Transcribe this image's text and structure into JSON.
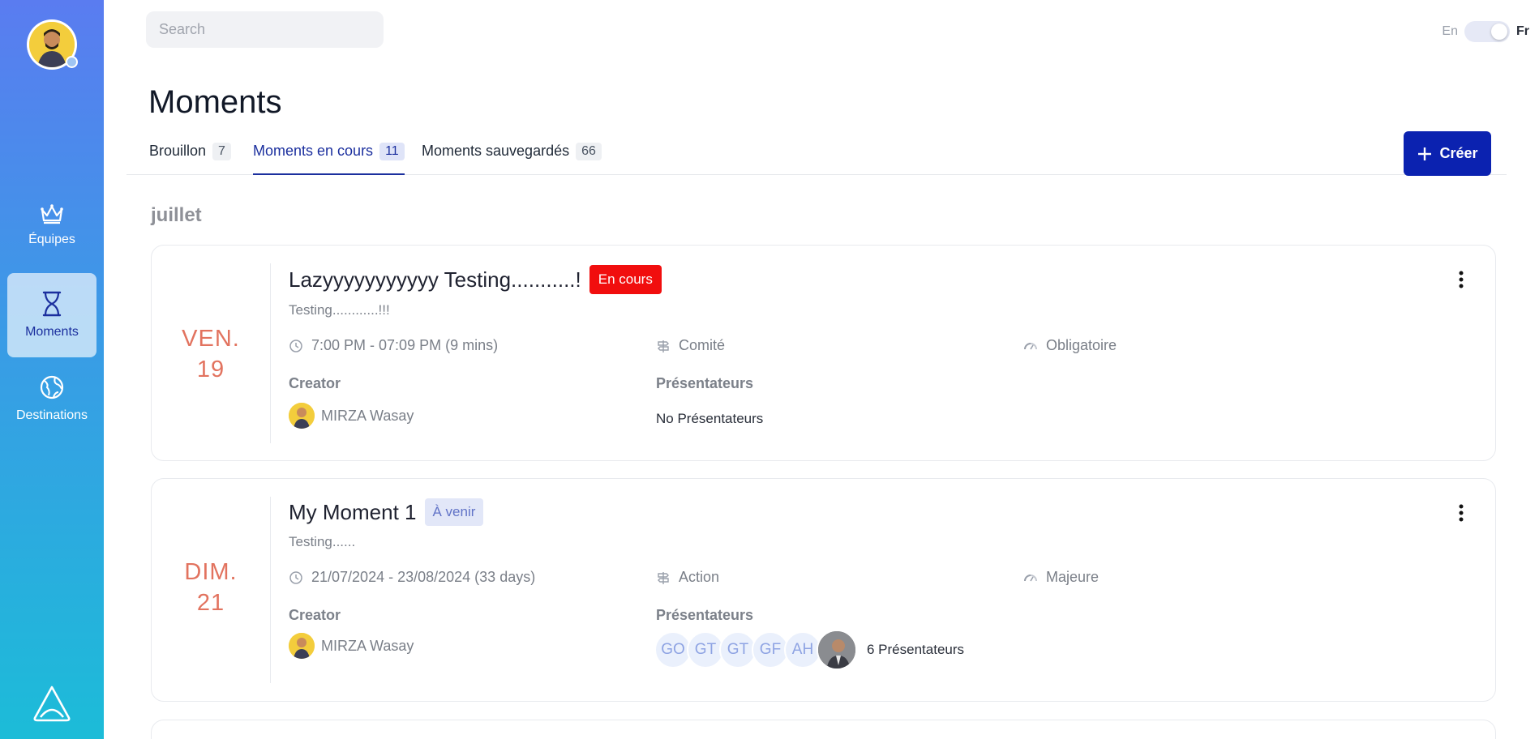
{
  "sidebar": {
    "items": [
      {
        "label": "Équipes",
        "icon": "crown-icon",
        "active": false
      },
      {
        "label": "Moments",
        "icon": "hourglass-icon",
        "active": true
      },
      {
        "label": "Destinations",
        "icon": "globe-icon",
        "active": false
      }
    ]
  },
  "search": {
    "placeholder": "Search"
  },
  "language": {
    "en": "En",
    "fr": "Fr",
    "selected": "Fr"
  },
  "page": {
    "title": "Moments"
  },
  "tabs": [
    {
      "label": "Brouillon",
      "count": "7"
    },
    {
      "label": "Moments en cours",
      "count": "11",
      "active": true
    },
    {
      "label": "Moments sauvegardés",
      "count": "66"
    }
  ],
  "create_button": {
    "label": "Créer"
  },
  "month": "juillet",
  "moments": [
    {
      "day": "VEN.",
      "date": "19",
      "title": "Lazyyyyyyyyyyy Testing...........!",
      "status": "En cours",
      "description": "Testing............!!!",
      "time": "7:00 PM - 07:09 PM (9 mins)",
      "category": "Comité",
      "importance": "Obligatoire",
      "creator_label": "Creator",
      "creator_name": "MIRZA Wasay",
      "presenters_label": "Présentateurs",
      "presenters_text": "No Présentateurs"
    },
    {
      "day": "DIM.",
      "date": "21",
      "title": "My Moment 1",
      "status": "À venir",
      "description": "Testing......",
      "time": "21/07/2024 - 23/08/2024 (33 days)",
      "category": "Action",
      "importance": "Majeure",
      "creator_label": "Creator",
      "creator_name": "MIRZA Wasay",
      "presenters_label": "Présentateurs",
      "presenter_initials": [
        "GO",
        "GT",
        "GT",
        "GF",
        "AH"
      ],
      "presenters_count_text": "6 Présentateurs"
    }
  ],
  "colors": {
    "accent": "#0b22b0",
    "active_tab": "#1b2f9e",
    "date": "#e2735f",
    "status_live": "#f10e0e"
  }
}
